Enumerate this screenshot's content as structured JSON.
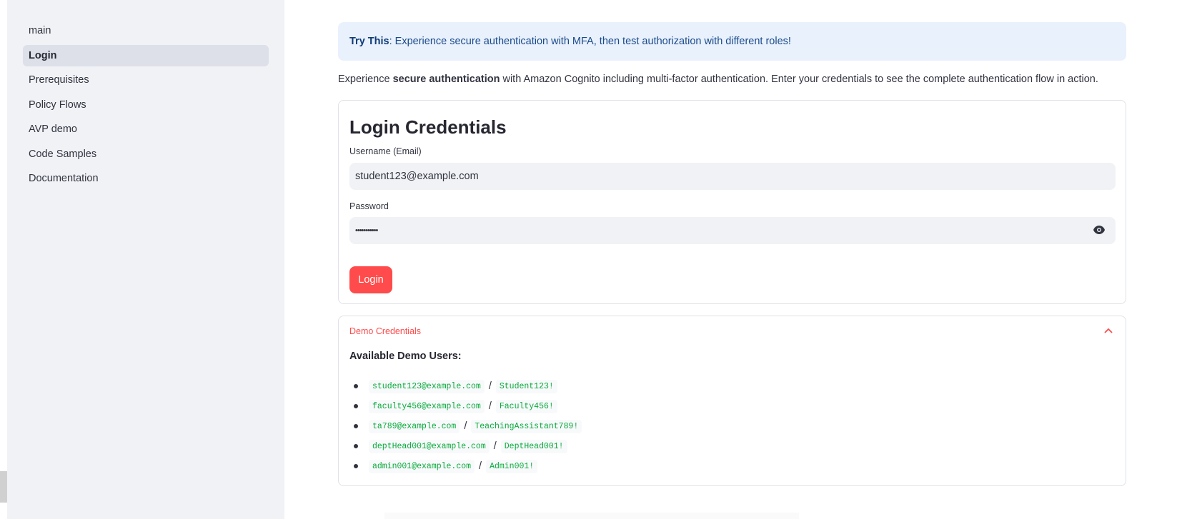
{
  "sidebar": {
    "items": [
      {
        "label": "main",
        "active": false
      },
      {
        "label": "Login",
        "active": true
      },
      {
        "label": "Prerequisites",
        "active": false
      },
      {
        "label": "Policy Flows",
        "active": false
      },
      {
        "label": "AVP demo",
        "active": false
      },
      {
        "label": "Code Samples",
        "active": false
      },
      {
        "label": "Documentation",
        "active": false
      }
    ]
  },
  "info": {
    "bold": "Try This",
    "text": ": Experience secure authentication with MFA, then test authorization with different roles!"
  },
  "intro": {
    "pre": "Experience ",
    "bold": "secure authentication",
    "post": " with Amazon Cognito including multi-factor authentication. Enter your credentials to see the complete authentication flow in action."
  },
  "form": {
    "title": "Login Credentials",
    "username_label": "Username (Email)",
    "username_value": "student123@example.com",
    "password_label": "Password",
    "password_value": "•••••••••••",
    "login_label": "Login"
  },
  "demo": {
    "header": "Demo Credentials",
    "subtitle": "Available Demo Users:",
    "users": [
      {
        "email": "student123@example.com",
        "password": "Student123!"
      },
      {
        "email": "faculty456@example.com",
        "password": "Faculty456!"
      },
      {
        "email": "ta789@example.com",
        "password": "TeachingAssistant789!"
      },
      {
        "email": "deptHead001@example.com",
        "password": "DeptHead001!"
      },
      {
        "email": "admin001@example.com",
        "password": "Admin001!"
      }
    ],
    "separator": "/"
  },
  "colors": {
    "accent": "#ff4b4b",
    "code_green": "#09ab3b",
    "info_bg": "#e8f1fc",
    "sidebar_bg": "#f0f2f6"
  },
  "icons": {
    "password_toggle": "eye-icon",
    "expander": "chevron-up-icon"
  }
}
